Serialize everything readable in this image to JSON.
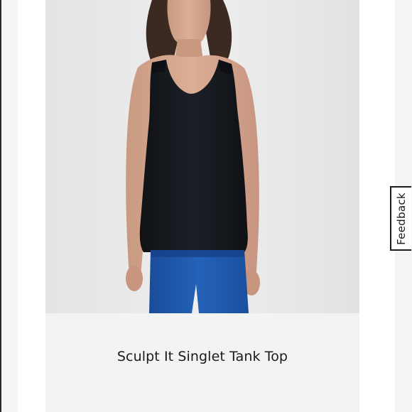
{
  "product": {
    "title": "Sculpt It Singlet Tank Top",
    "image_alt": "Model wearing black singlet tank top with blue leggings"
  },
  "feedback": {
    "label": "Feedback"
  },
  "colors": {
    "tank": "#15171c",
    "leggings": "#1f56a8",
    "background": "#e8e8e8",
    "panel": "#f3f3f3"
  }
}
